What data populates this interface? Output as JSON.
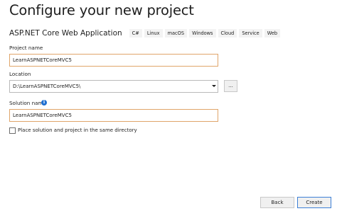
{
  "header": {
    "title": "Configure your new project"
  },
  "template": {
    "name": "ASP.NET Core Web Application",
    "tags": [
      "C#",
      "Linux",
      "macOS",
      "Windows",
      "Cloud",
      "Service",
      "Web"
    ]
  },
  "form": {
    "project_name_label": "Project name",
    "project_name_value": "LearnASPNETCoreMVC5",
    "location_label": "Location",
    "location_value": "D:\\LearnASPNETCoreMVC5\\",
    "browse_label": "...",
    "solution_name_label": "Solution name",
    "solution_name_value": "LearnASPNETCoreMVC5",
    "same_dir_label": "Place solution and project in the same directory",
    "same_dir_checked": false
  },
  "footer": {
    "back_label": "Back",
    "create_label": "Create"
  },
  "colors": {
    "focus_border": "#e0a56a",
    "primary_border": "#3c7fd6",
    "info_icon": "#1f6fd1"
  }
}
